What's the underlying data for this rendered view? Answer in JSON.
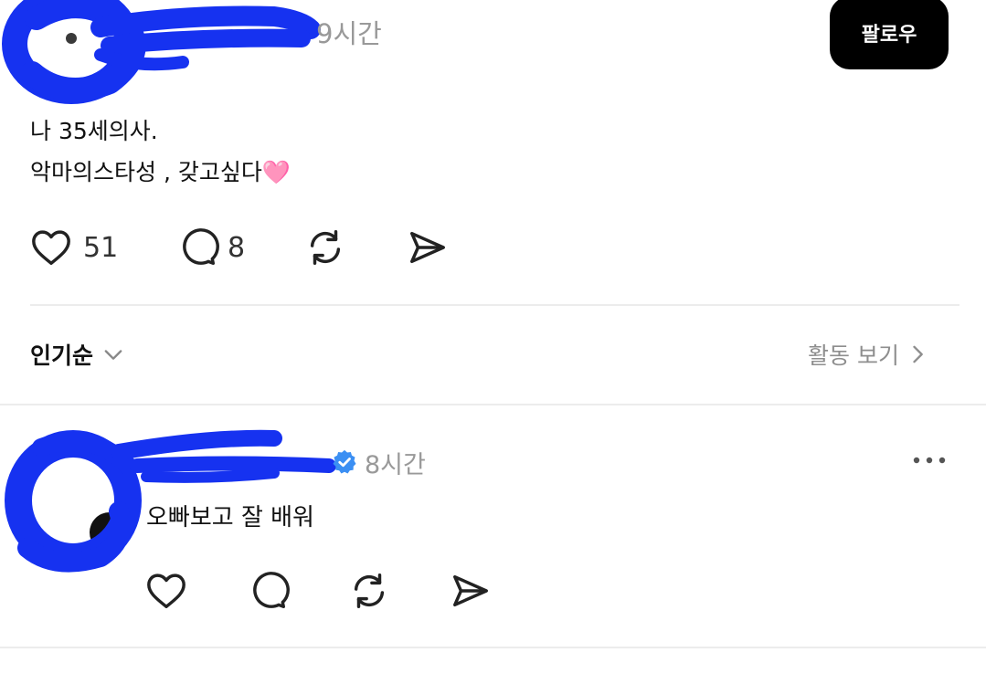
{
  "post": {
    "time": "9시간",
    "follow_label": "팔로우",
    "text_line1": "나 35세의사.",
    "text_line2": "악마의스타성 , 갖고싶다",
    "emoji": "🩷",
    "like_count": "51",
    "comment_count": "8"
  },
  "sort": {
    "label": "인기순",
    "activity_label": "활동 보기"
  },
  "reply": {
    "time": "8시간",
    "text": "오빠보고 잘 배워"
  },
  "colors": {
    "scribble": "#1632f0",
    "follow_bg": "#000000",
    "verified": "#3b8ff3"
  }
}
